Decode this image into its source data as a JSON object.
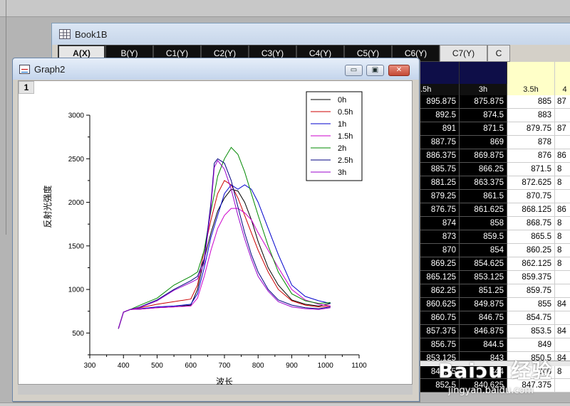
{
  "book": {
    "title": "Book1B",
    "columns": [
      "A(X)",
      "B(Y)",
      "C1(Y)",
      "C2(Y)",
      "C3(Y)",
      "C4(Y)",
      "C5(Y)",
      "C6(Y)",
      "C7(Y)",
      "C"
    ],
    "visible_names": [
      "2.5h",
      "3h",
      "3.5h",
      "4"
    ],
    "rows": [
      [
        "895.875",
        "875.875",
        "885",
        "87"
      ],
      [
        "892.5",
        "874.5",
        "883",
        ""
      ],
      [
        "891",
        "871.5",
        "879.75",
        "87"
      ],
      [
        "887.75",
        "869",
        "878",
        ""
      ],
      [
        "886.375",
        "869.875",
        "876",
        "86"
      ],
      [
        "885.75",
        "866.25",
        "871.5",
        "8"
      ],
      [
        "881.25",
        "863.375",
        "872.625",
        "8"
      ],
      [
        "879.25",
        "861.5",
        "870.75",
        ""
      ],
      [
        "876.75",
        "861.625",
        "868.125",
        "86"
      ],
      [
        "874",
        "858",
        "868.75",
        "8"
      ],
      [
        "873",
        "859.5",
        "865.5",
        "8"
      ],
      [
        "870",
        "854",
        "860.25",
        "8"
      ],
      [
        "869.25",
        "854.625",
        "862.125",
        "8"
      ],
      [
        "865.125",
        "853.125",
        "859.375",
        ""
      ],
      [
        "862.25",
        "851.25",
        "859.75",
        ""
      ],
      [
        "860.625",
        "849.875",
        "855",
        "84"
      ],
      [
        "860.75",
        "846.75",
        "854.75",
        ""
      ],
      [
        "857.375",
        "846.875",
        "853.5",
        "84"
      ],
      [
        "856.75",
        "844.5",
        "849",
        ""
      ],
      [
        "853.125",
        "843",
        "850.5",
        "84"
      ],
      [
        "849.75",
        "844",
        "846",
        "8"
      ],
      [
        "852.5",
        "840.625",
        "847.375",
        ""
      ]
    ]
  },
  "graph": {
    "title": "Graph2",
    "layer": "1",
    "buttons": {
      "minimize": "▭",
      "restore": "▣",
      "close": "✕"
    }
  },
  "chart_data": {
    "type": "line",
    "xlabel": "波长",
    "ylabel": "反射光强度",
    "xlim": [
      300,
      1100
    ],
    "ylim": [
      250,
      3000
    ],
    "xticks": [
      300,
      400,
      500,
      600,
      700,
      800,
      900,
      1000,
      1100
    ],
    "yticks": [
      500,
      1000,
      1500,
      2000,
      2500,
      3000
    ],
    "legend_position": "top-right",
    "grid": false,
    "series": [
      {
        "name": "0h",
        "color": "#000000",
        "x": [
          385,
          400,
          420,
          450,
          500,
          550,
          600,
          620,
          640,
          660,
          680,
          700,
          720,
          740,
          760,
          780,
          800,
          830,
          860,
          900,
          940,
          980,
          1015
        ],
        "y": [
          550,
          740,
          770,
          775,
          790,
          800,
          820,
          1000,
          1350,
          1650,
          1900,
          2050,
          2150,
          2130,
          2000,
          1800,
          1550,
          1250,
          1050,
          880,
          830,
          810,
          840
        ]
      },
      {
        "name": "0.5h",
        "color": "#cc0000",
        "x": [
          385,
          400,
          420,
          450,
          500,
          550,
          600,
          620,
          640,
          660,
          680,
          700,
          720,
          740,
          760,
          780,
          800,
          830,
          860,
          900,
          940,
          980,
          1015
        ],
        "y": [
          550,
          740,
          770,
          790,
          830,
          860,
          890,
          1050,
          1450,
          1800,
          2100,
          2250,
          2200,
          2050,
          1850,
          1650,
          1450,
          1200,
          1000,
          870,
          820,
          800,
          810
        ]
      },
      {
        "name": "1h",
        "color": "#0000cc",
        "x": [
          385,
          400,
          420,
          450,
          500,
          550,
          600,
          620,
          640,
          660,
          680,
          700,
          720,
          740,
          760,
          780,
          800,
          830,
          860,
          900,
          940,
          980,
          1015
        ],
        "y": [
          550,
          740,
          770,
          780,
          800,
          810,
          830,
          950,
          1250,
          1600,
          1850,
          2100,
          2200,
          2150,
          2200,
          2150,
          2000,
          1700,
          1400,
          1050,
          920,
          870,
          840
        ]
      },
      {
        "name": "1.5h",
        "color": "#cc00cc",
        "x": [
          385,
          400,
          420,
          450,
          500,
          550,
          600,
          620,
          640,
          660,
          680,
          700,
          720,
          740,
          760,
          780,
          800,
          830,
          860,
          900,
          940,
          980,
          1015
        ],
        "y": [
          550,
          740,
          770,
          775,
          790,
          800,
          810,
          900,
          1150,
          1450,
          1700,
          1850,
          1930,
          1930,
          1880,
          1800,
          1650,
          1450,
          1250,
          1000,
          880,
          830,
          810
        ]
      },
      {
        "name": "2h",
        "color": "#008800",
        "x": [
          385,
          400,
          420,
          450,
          500,
          550,
          600,
          620,
          640,
          660,
          680,
          700,
          720,
          740,
          760,
          780,
          800,
          830,
          860,
          900,
          940,
          980,
          1015
        ],
        "y": [
          550,
          740,
          770,
          820,
          900,
          1050,
          1150,
          1200,
          1450,
          1900,
          2300,
          2500,
          2630,
          2550,
          2350,
          2100,
          1850,
          1500,
          1200,
          950,
          870,
          840,
          850
        ]
      },
      {
        "name": "2.5h",
        "color": "#000080",
        "x": [
          385,
          400,
          420,
          450,
          500,
          550,
          600,
          620,
          640,
          660,
          670,
          680,
          700,
          720,
          740,
          760,
          780,
          800,
          830,
          860,
          900,
          940,
          980,
          1015
        ],
        "y": [
          550,
          740,
          770,
          800,
          880,
          1000,
          1100,
          1150,
          1350,
          2000,
          2450,
          2500,
          2450,
          2250,
          1950,
          1650,
          1400,
          1200,
          1000,
          880,
          820,
          790,
          780,
          800
        ]
      },
      {
        "name": "3h",
        "color": "#9900cc",
        "x": [
          385,
          400,
          420,
          450,
          500,
          550,
          600,
          620,
          640,
          660,
          670,
          680,
          700,
          720,
          740,
          760,
          780,
          800,
          830,
          860,
          900,
          940,
          980,
          1015
        ],
        "y": [
          550,
          740,
          770,
          795,
          870,
          990,
          1080,
          1120,
          1300,
          1950,
          2400,
          2480,
          2380,
          2150,
          1850,
          1580,
          1350,
          1150,
          980,
          860,
          800,
          780,
          770,
          790
        ]
      }
    ]
  }
}
